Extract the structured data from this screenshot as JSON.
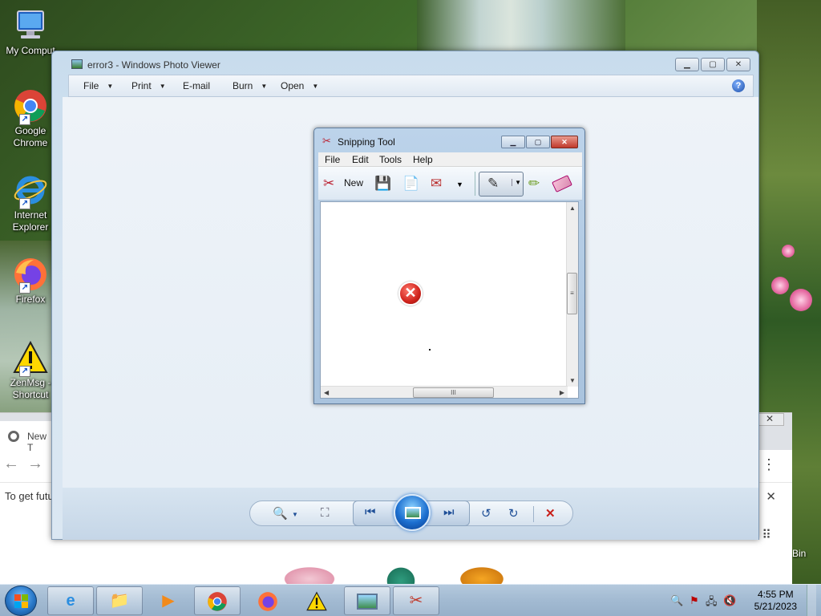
{
  "desktop": {
    "icons": [
      {
        "label": "My Comput",
        "icon": "computer-icon"
      },
      {
        "label": "Google Chrome",
        "icon": "chrome-icon"
      },
      {
        "label": "Internet Explorer",
        "icon": "ie-icon"
      },
      {
        "label": "Firefox",
        "icon": "firefox-icon"
      },
      {
        "label": "ZenMsg - Shortcut",
        "icon": "warning-icon"
      }
    ],
    "bin_label": "Bin"
  },
  "chrome_background": {
    "tab_label": "New T",
    "info_text": "To get futu",
    "close_glyph": "✕",
    "more_glyph": "⋮",
    "apps_glyph": "⠿"
  },
  "photo_viewer": {
    "title": "error3 - Windows Photo Viewer",
    "menus": [
      {
        "label": "File",
        "has_caret": true
      },
      {
        "label": "Print",
        "has_caret": true
      },
      {
        "label": "E-mail",
        "has_caret": false
      },
      {
        "label": "Burn",
        "has_caret": true
      },
      {
        "label": "Open",
        "has_caret": true
      }
    ],
    "help_glyph": "?",
    "controls": {
      "zoom": "🔍",
      "actual_size": "⛶",
      "previous": "⏮",
      "next": "⏭",
      "rotate_ccw": "↺",
      "rotate_cw": "↻",
      "delete": "✕"
    }
  },
  "snipping_tool": {
    "title": "Snipping Tool",
    "menus": [
      "File",
      "Edit",
      "Tools",
      "Help"
    ],
    "toolbar": {
      "new_label": "New"
    },
    "image": {
      "error_glyph": "✕"
    }
  },
  "taskbar": {
    "clock_time": "4:55 PM",
    "clock_date": "5/21/2023",
    "buttons": [
      {
        "name": "ie",
        "icon": "ie-icon",
        "active": true
      },
      {
        "name": "explorer",
        "icon": "folder-icon",
        "active": true
      },
      {
        "name": "media-player",
        "icon": "media-player-icon",
        "active": false
      },
      {
        "name": "chrome",
        "icon": "chrome-icon",
        "active": true
      },
      {
        "name": "firefox",
        "icon": "firefox-icon",
        "active": false
      },
      {
        "name": "zenmsg",
        "icon": "warning-icon",
        "active": false
      },
      {
        "name": "photo-viewer",
        "icon": "photo-viewer-icon",
        "active": true
      },
      {
        "name": "snipping-tool",
        "icon": "scissors-icon",
        "active": true
      }
    ]
  },
  "colors": {
    "accent": "#1c6fd0",
    "error_red": "#d0231c",
    "taskbar": "#a2bad2"
  }
}
